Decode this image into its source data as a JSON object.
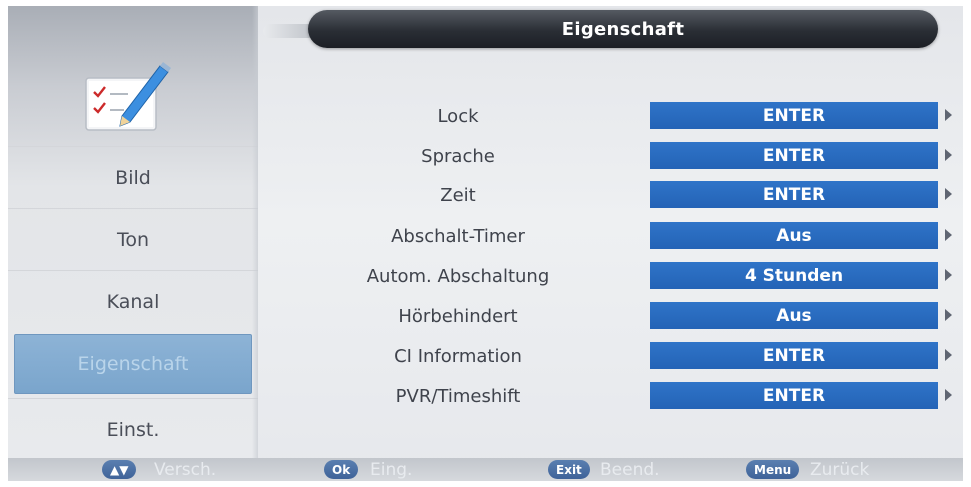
{
  "header": {
    "title": "Eigenschaft"
  },
  "sidebar": {
    "icon": "checklist-pencil-icon",
    "items": [
      {
        "label": "Bild",
        "active": false
      },
      {
        "label": "Ton",
        "active": false
      },
      {
        "label": "Kanal",
        "active": false
      },
      {
        "label": "Eigenschaft",
        "active": true
      },
      {
        "label": "Einst.",
        "active": false
      }
    ]
  },
  "settings": {
    "rows": [
      {
        "label": "Lock",
        "value": "ENTER"
      },
      {
        "label": "Sprache",
        "value": "ENTER"
      },
      {
        "label": "Zeit",
        "value": "ENTER"
      },
      {
        "label": "Abschalt-Timer",
        "value": "Aus"
      },
      {
        "label": "Autom. Abschaltung",
        "value": "4 Stunden"
      },
      {
        "label": "Hörbehindert",
        "value": "Aus"
      },
      {
        "label": "CI Information",
        "value": "ENTER"
      },
      {
        "label": "PVR/Timeshift",
        "value": "ENTER"
      }
    ]
  },
  "footer": {
    "hints": [
      {
        "key": "▲▼",
        "label": "Versch."
      },
      {
        "key": "Ok",
        "label": "Eing."
      },
      {
        "key": "Exit",
        "label": "Beend."
      },
      {
        "key": "Menu",
        "label": "Zurück"
      }
    ]
  },
  "colors": {
    "value_bar": "#2a6bbf",
    "active_item": "#86aed3",
    "header": "#2a2e35"
  }
}
